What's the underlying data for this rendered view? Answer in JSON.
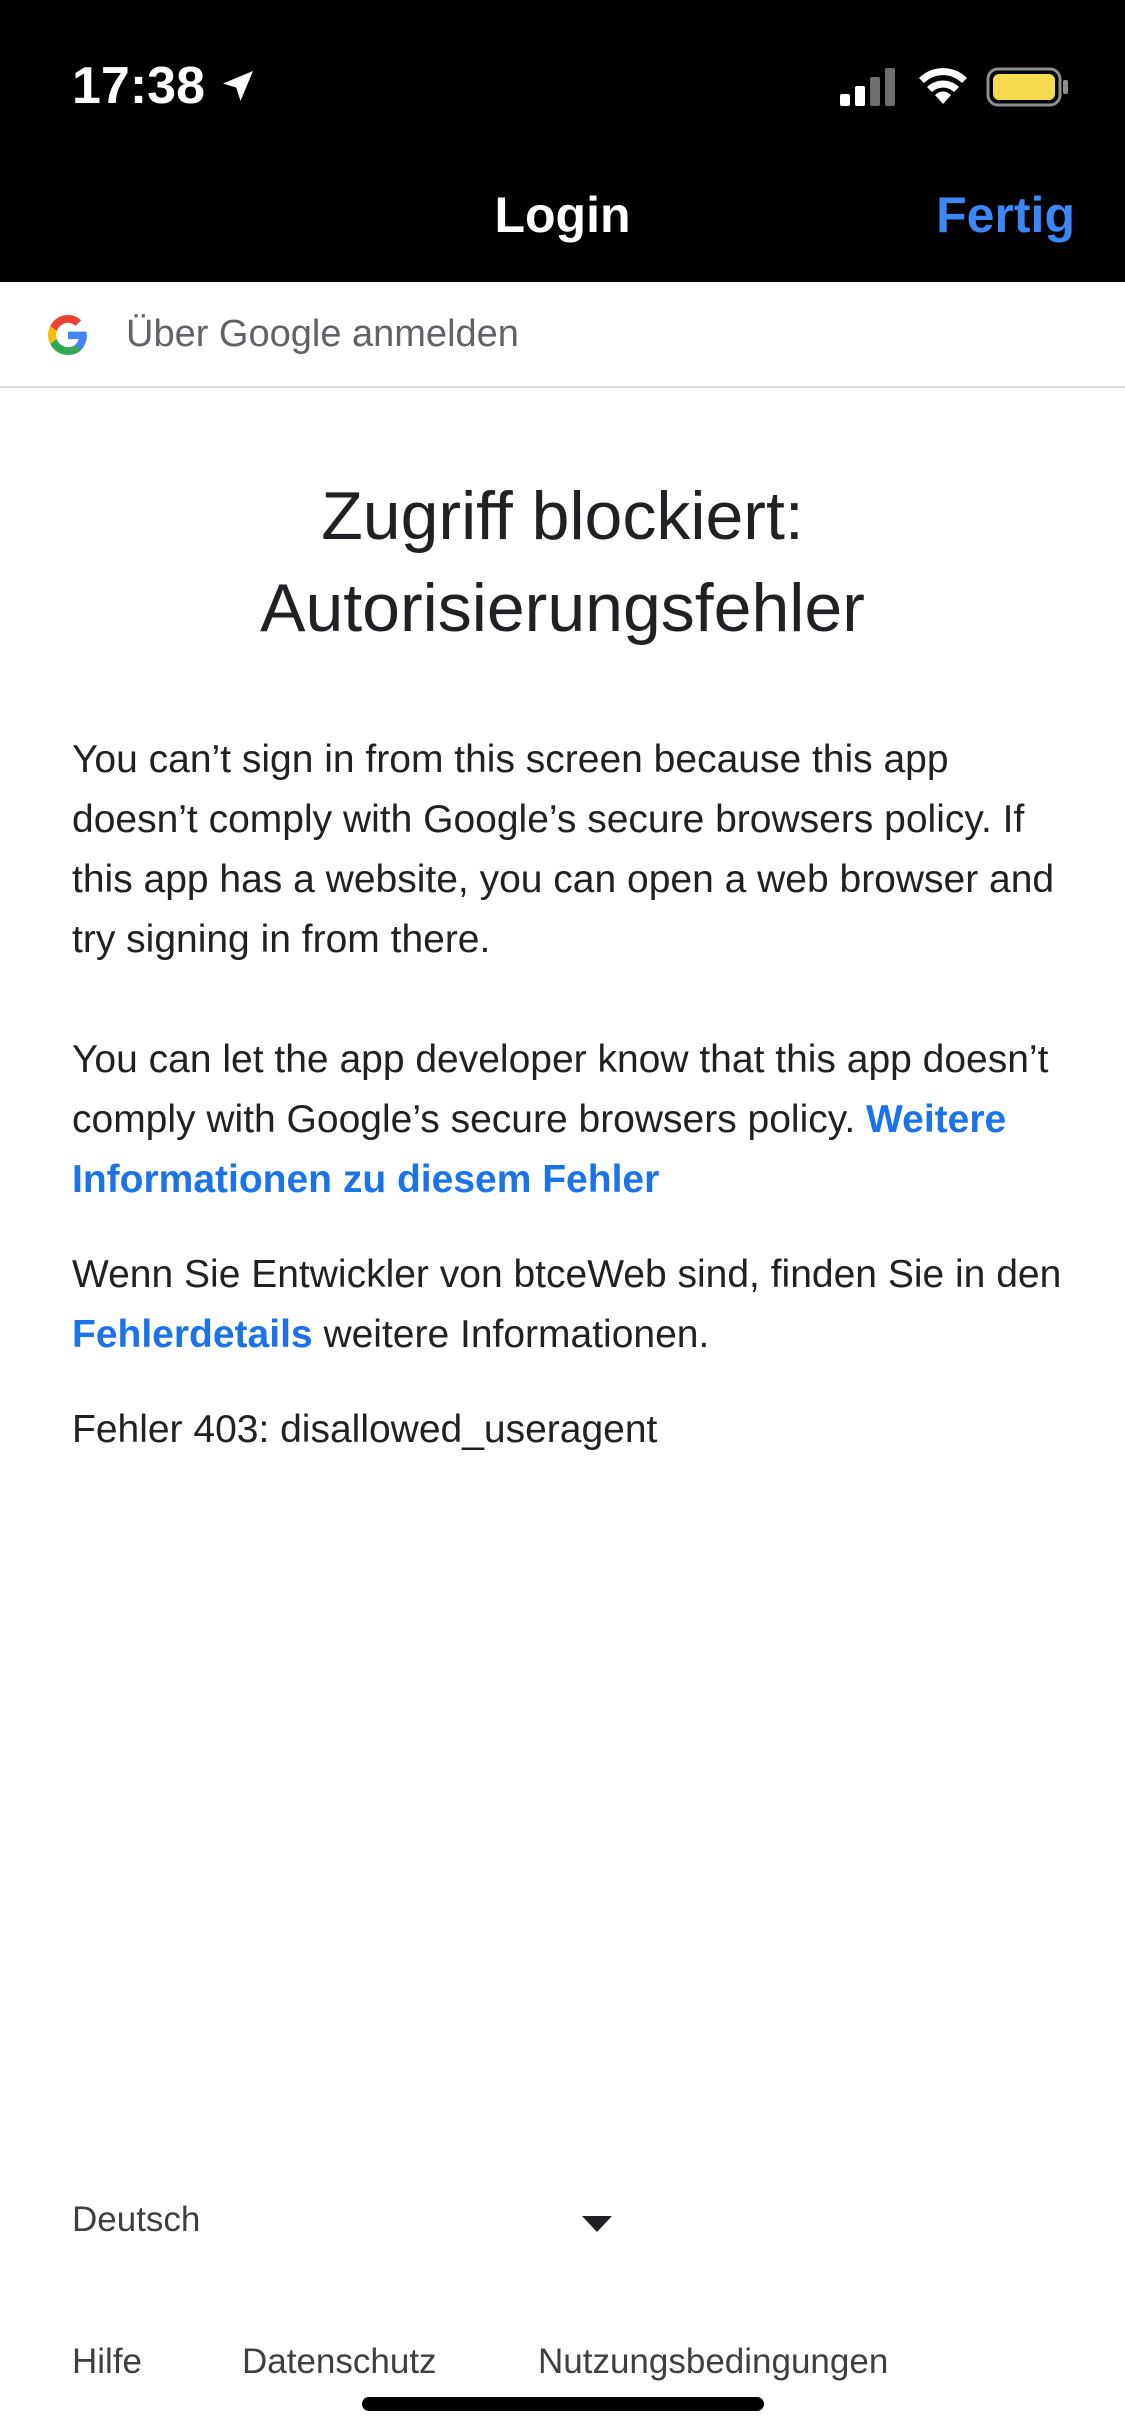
{
  "status_bar": {
    "time": "17:38",
    "icons": [
      "location-arrow-icon",
      "cellular-signal-icon",
      "wifi-icon",
      "battery-icon"
    ],
    "battery_color": "#f5d94e"
  },
  "nav": {
    "title": "Login",
    "done_label": "Fertig",
    "done_color": "#3d86f5"
  },
  "google_header": {
    "icon": "google-logo-icon",
    "text": "Über Google anmelden"
  },
  "content": {
    "heading_line1": "Zugriff blockiert:",
    "heading_line2": "Autorisierungsfehler",
    "paragraph1": "You can’t sign in from this screen because this app doesn’t comply with Google’s secure browsers policy. If this app has a website, you can open a web browser and try signing in from there.",
    "paragraph2_text": "You can let the app developer know that this app doesn’t comply with Google’s secure browsers policy.",
    "paragraph2_link": "Weitere Informationen zu diesem Fehler",
    "paragraph3_before": "Wenn Sie Entwickler von btceWeb sind, finden Sie in den",
    "paragraph3_link": "Fehlerdetails",
    "paragraph3_after": "weitere Informationen.",
    "error_code": "Fehler 403: disallowed_useragent",
    "link_color": "#1a73e8"
  },
  "footer": {
    "language": "Deutsch",
    "links": [
      "Hilfe",
      "Datenschutz",
      "Nutzungsbedingungen"
    ]
  }
}
